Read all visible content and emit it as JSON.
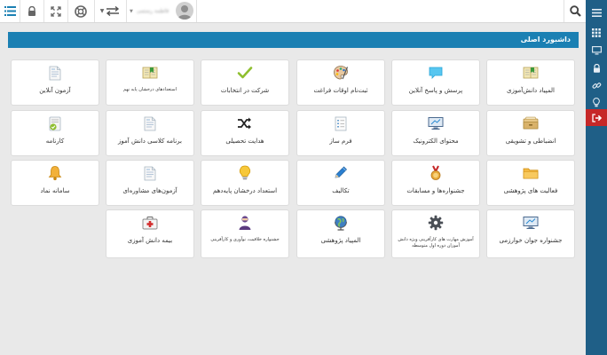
{
  "topbar": {
    "user_name": "فاطمه رستمی",
    "search_icon": "search-icon",
    "menu_icon": "menu-icon"
  },
  "header": {
    "title": "داشبورد اصلی"
  },
  "tiles": [
    {
      "label": "المپیاد دانش‌آموزی",
      "icon": "book-icon"
    },
    {
      "label": "پرسش و پاسخ آنلاین",
      "icon": "chat-icon"
    },
    {
      "label": "ثبت‌نام اوقات فراغت",
      "icon": "palette-icon"
    },
    {
      "label": "شرکت در انتخابات",
      "icon": "check-icon"
    },
    {
      "label": "استعدادهای درخشان پایه نهم",
      "icon": "book-icon"
    },
    {
      "label": "آزمون آنلاین",
      "icon": "document-icon"
    },
    {
      "label": "انضباطی و تشویقی",
      "icon": "drawer-icon"
    },
    {
      "label": "محتوای الکترونیک",
      "icon": "monitor-icon"
    },
    {
      "label": "فرم ساز",
      "icon": "form-icon"
    },
    {
      "label": "هدایت تحصیلی",
      "icon": "shuffle-icon"
    },
    {
      "label": "برنامه کلاسی دانش آموز",
      "icon": "document-icon"
    },
    {
      "label": "کارنامه",
      "icon": "report-card-icon"
    },
    {
      "label": "فعالیت های پژوهشی",
      "icon": "folder-icon"
    },
    {
      "label": "جشنواره‌ها و مسابقات",
      "icon": "medal-icon"
    },
    {
      "label": "تکالیف",
      "icon": "pencil-icon"
    },
    {
      "label": "استعداد درخشان پایه‌دهم",
      "icon": "lightbulb-icon"
    },
    {
      "label": "آزمون‌های مشاوره‌ای",
      "icon": "document-icon"
    },
    {
      "label": "سامانه نماد",
      "icon": "bell-icon"
    },
    {
      "label": "جشنواره جوان خوارزمی",
      "icon": "monitor-icon"
    },
    {
      "label": "آموزش مهارت های کارآفرینی ویژه دانش آموزان دوره اول متوسطه",
      "icon": "gear-icon"
    },
    {
      "label": "المپیاد پژوهشی",
      "icon": "globe-icon"
    },
    {
      "label": "جشنواره خلاقیت، نوآوری و کارآفرینی",
      "icon": "person-icon"
    },
    {
      "label": "بیمه دانش آموزی",
      "icon": "first-aid-icon"
    }
  ],
  "colors": {
    "accent": "#1b80b3",
    "sidebar": "#1f5f87",
    "active": "#c62828"
  }
}
